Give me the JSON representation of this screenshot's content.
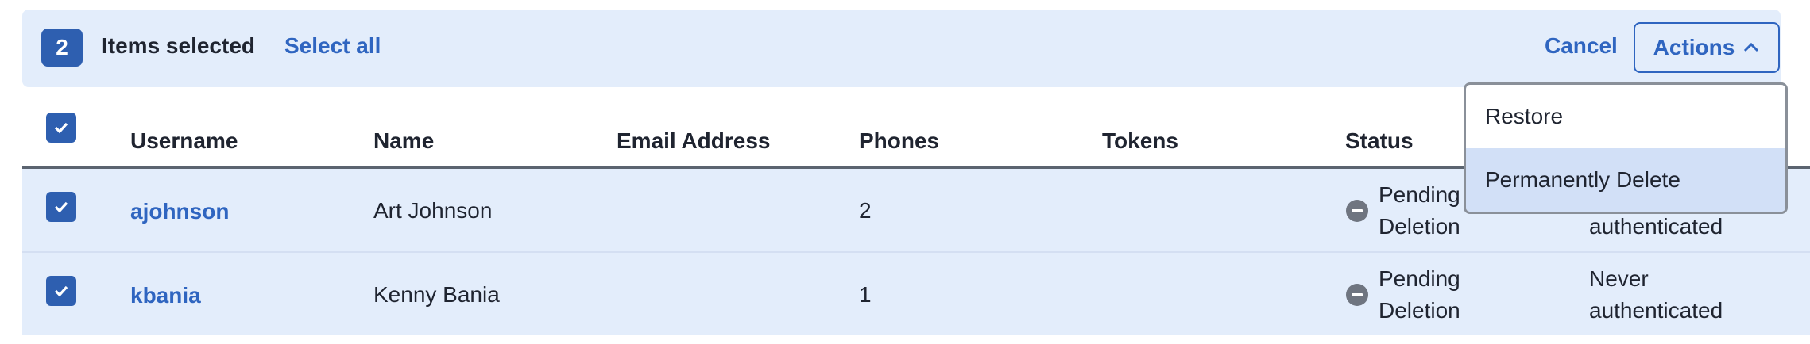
{
  "selection_bar": {
    "count": "2",
    "label": "Items selected",
    "select_all": "Select all",
    "cancel": "Cancel",
    "actions": "Actions"
  },
  "actions_menu": [
    "Restore",
    "Permanently Delete"
  ],
  "table": {
    "columns": [
      "Username",
      "Name",
      "Email Address",
      "Phones",
      "Tokens",
      "Status"
    ],
    "rows": [
      {
        "username": "ajohnson",
        "name": "Art Johnson",
        "email": "",
        "phones": "2",
        "tokens": "",
        "status_line1": "Pending",
        "status_line2": "Deletion",
        "last_line1": "",
        "last_line2": "authenticated",
        "checked": true
      },
      {
        "username": "kbania",
        "name": "Kenny Bania",
        "email": "",
        "phones": "1",
        "tokens": "",
        "status_line1": "Pending",
        "status_line2": "Deletion",
        "last_line1": "Never",
        "last_line2": "authenticated",
        "checked": true
      }
    ]
  },
  "icons": {
    "checkbox": "check-icon",
    "status": "minus-circle-icon",
    "actions": "chevron-up-icon"
  },
  "colors": {
    "accent": "#2f65c0",
    "selection_bg": "#e3edfb",
    "menu_highlight": "#d2e0f7"
  }
}
